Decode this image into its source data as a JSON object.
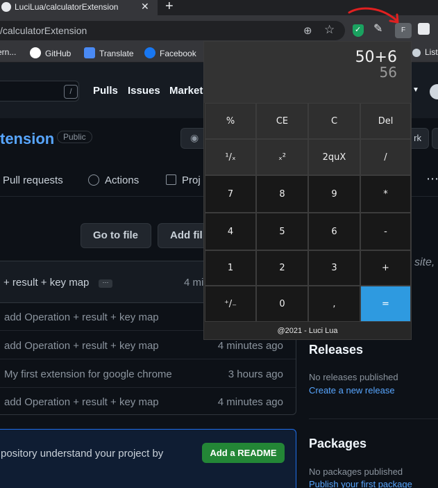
{
  "browser": {
    "tab_title": "LuciLua/calculatorExtension",
    "tab_close": "✕",
    "new_tab": "+",
    "url": "/calculatorExtension",
    "extension_badge": "F",
    "bookmarks": [
      {
        "label": "ern...",
        "icon_color": "#c9d1d9"
      },
      {
        "label": "GitHub",
        "icon_color": "#ffffff"
      },
      {
        "label": "Translate",
        "icon_color": "#4a8af4"
      },
      {
        "label": "Facebook",
        "icon_color": "#1877f2"
      },
      {
        "label": "Lista",
        "icon_color": "#c9d1d9"
      }
    ],
    "annotation_color": "#e02020"
  },
  "github": {
    "slash_key": "/",
    "nav": [
      "Pulls",
      "Issues",
      "Market"
    ],
    "repo_name": "tension",
    "visibility": "Public",
    "fork_partial": "rk",
    "tabs": [
      "Pull requests",
      "Actions",
      "Proj"
    ],
    "go_to_file": "Go to file",
    "add_file": "Add fil",
    "commit_header": {
      "message": "+ result + key map",
      "ellipsis": "···",
      "time": "4 mi"
    },
    "commits": [
      {
        "message": "add Operation + result + key map",
        "time": ""
      },
      {
        "message": "add Operation + result + key map",
        "time": "4 minutes ago"
      },
      {
        "message": "My first extension for google chrome",
        "time": "3 hours ago"
      },
      {
        "message": "add Operation + result + key map",
        "time": "4 minutes ago"
      }
    ],
    "readme_prompt": "pository understand your project by",
    "add_readme": "Add a README",
    "side_partial": "site, c",
    "releases": {
      "heading": "Releases",
      "empty": "No releases published",
      "link": "Create a new release"
    },
    "packages": {
      "heading": "Packages",
      "empty": "No packages published",
      "link": "Publish your first package"
    }
  },
  "calculator": {
    "expression": "50+6",
    "result": "56",
    "keys": [
      [
        "%",
        "CE",
        "C",
        "Del"
      ],
      [
        "¹/ₓ",
        "ₓ²",
        "2quX",
        "/"
      ],
      [
        "7",
        "8",
        "9",
        "*"
      ],
      [
        "4",
        "5",
        "6",
        "-"
      ],
      [
        "1",
        "2",
        "3",
        "+"
      ],
      [
        "⁺/₋",
        "0",
        ",",
        "="
      ]
    ],
    "footer": "@2021 - Luci Lua",
    "accent": "#2e9ae0"
  }
}
